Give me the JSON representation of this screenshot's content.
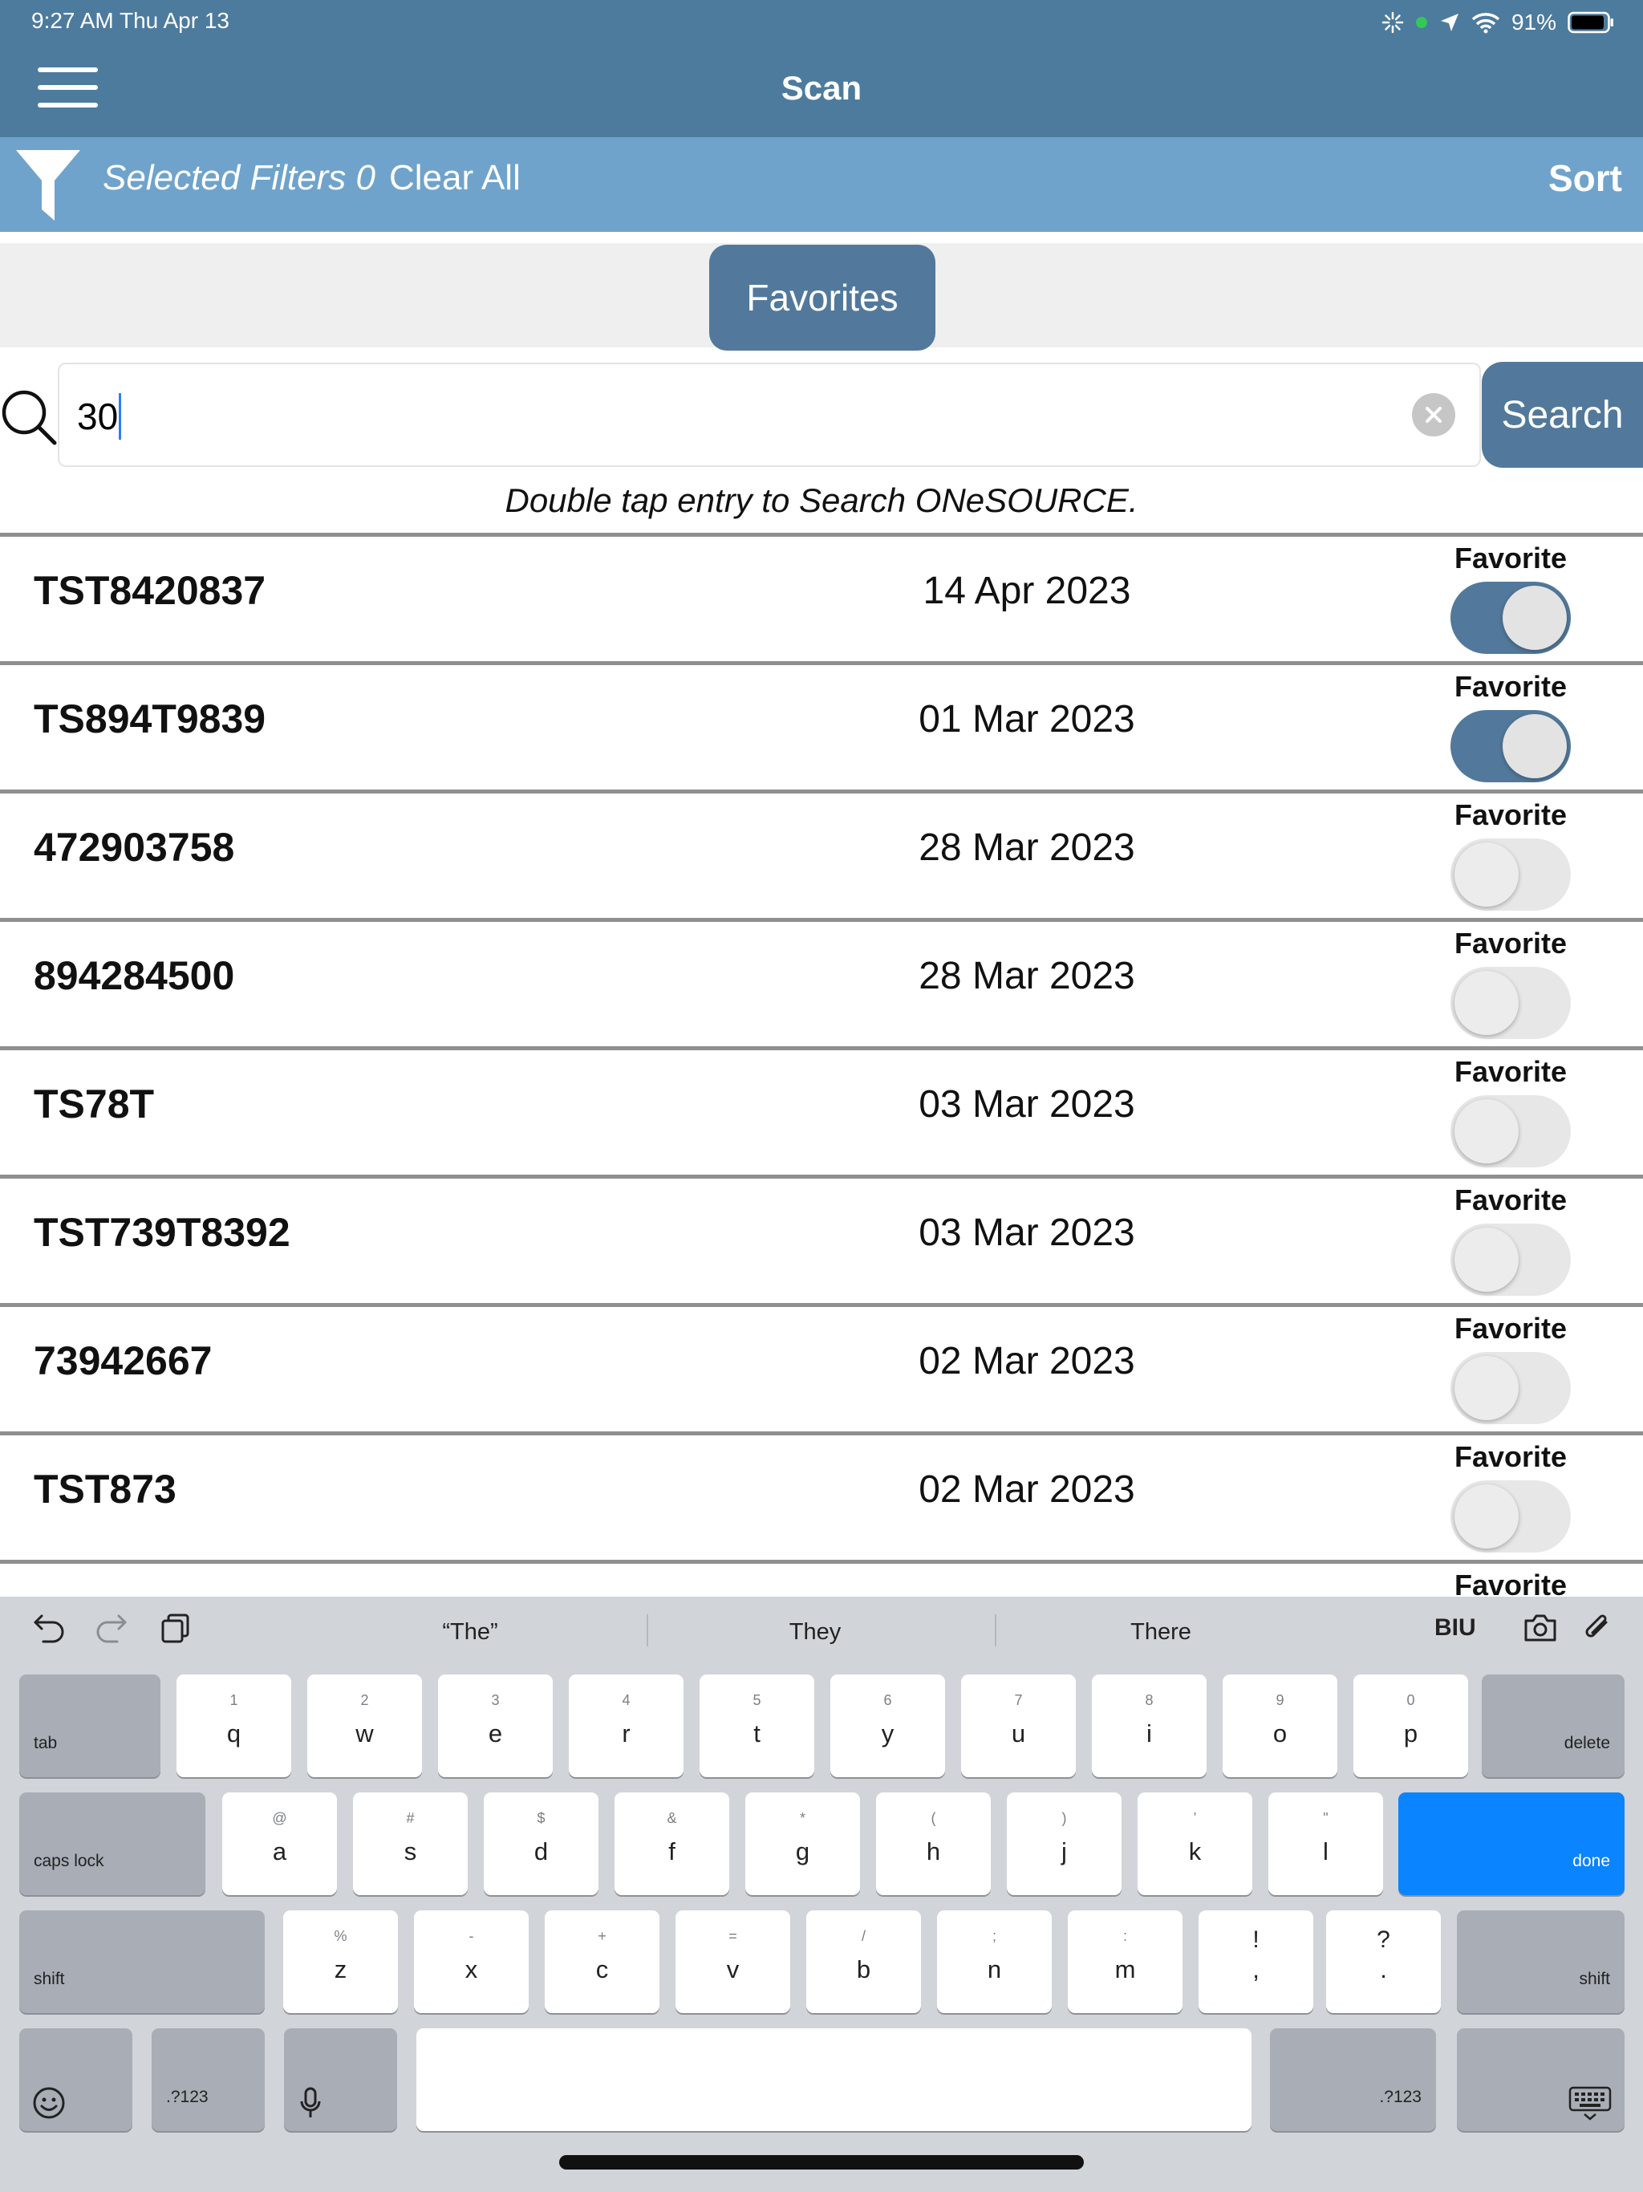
{
  "status": {
    "time": "9:27 AM  Thu Apr 13",
    "battery": "91%"
  },
  "nav": {
    "title": "Scan"
  },
  "filters": {
    "selected_label": "Selected Filters 0",
    "clear_all": "Clear All",
    "sort": "Sort"
  },
  "favorites_button": "Favorites",
  "search": {
    "value": "30",
    "button": "Search",
    "hint": "Double tap entry to Search ONeSOURCE."
  },
  "favorite_label": "Favorite",
  "rows": [
    {
      "id": "TST8420837",
      "date": "14 Apr 2023",
      "favorite": true
    },
    {
      "id": "TS894T9839",
      "date": "01 Mar 2023",
      "favorite": true
    },
    {
      "id": "472903758",
      "date": "28 Mar 2023",
      "favorite": false
    },
    {
      "id": "894284500",
      "date": "28 Mar 2023",
      "favorite": false
    },
    {
      "id": "TS78T",
      "date": "03 Mar 2023",
      "favorite": false
    },
    {
      "id": "TST739T8392",
      "date": "03 Mar 2023",
      "favorite": false
    },
    {
      "id": "73942667",
      "date": "02 Mar 2023",
      "favorite": false
    },
    {
      "id": "TST873",
      "date": "02 Mar 2023",
      "favorite": false
    },
    {
      "id": "",
      "date": "",
      "favorite": false
    }
  ],
  "keyboard": {
    "suggestions": [
      "“The”",
      "They",
      "There"
    ],
    "format_label": "BIU",
    "row1": [
      {
        "main": "q",
        "sub": "1"
      },
      {
        "main": "w",
        "sub": "2"
      },
      {
        "main": "e",
        "sub": "3"
      },
      {
        "main": "r",
        "sub": "4"
      },
      {
        "main": "t",
        "sub": "5"
      },
      {
        "main": "y",
        "sub": "6"
      },
      {
        "main": "u",
        "sub": "7"
      },
      {
        "main": "i",
        "sub": "8"
      },
      {
        "main": "o",
        "sub": "9"
      },
      {
        "main": "p",
        "sub": "0"
      }
    ],
    "row2": [
      {
        "main": "a",
        "sub": "@"
      },
      {
        "main": "s",
        "sub": "#"
      },
      {
        "main": "d",
        "sub": "$"
      },
      {
        "main": "f",
        "sub": "&"
      },
      {
        "main": "g",
        "sub": "*"
      },
      {
        "main": "h",
        "sub": "("
      },
      {
        "main": "j",
        "sub": ")"
      },
      {
        "main": "k",
        "sub": "’"
      },
      {
        "main": "l",
        "sub": "\""
      }
    ],
    "row3": [
      {
        "main": "z",
        "sub": "%"
      },
      {
        "main": "x",
        "sub": "-"
      },
      {
        "main": "c",
        "sub": "+"
      },
      {
        "main": "v",
        "sub": "="
      },
      {
        "main": "b",
        "sub": "/"
      },
      {
        "main": "n",
        "sub": ";"
      },
      {
        "main": "m",
        "sub": ":"
      },
      {
        "main": ",",
        "sub": "!"
      },
      {
        "main": ".",
        "sub": "?"
      }
    ],
    "tab": "tab",
    "delete": "delete",
    "caps_lock": "caps lock",
    "done": "done",
    "shift": "shift",
    "numbers": ".?123"
  },
  "colors": {
    "header": "#4d7b9d",
    "filter_bar": "#6fa3cb",
    "accent": "#52799b",
    "done_key": "#0a84ff"
  }
}
